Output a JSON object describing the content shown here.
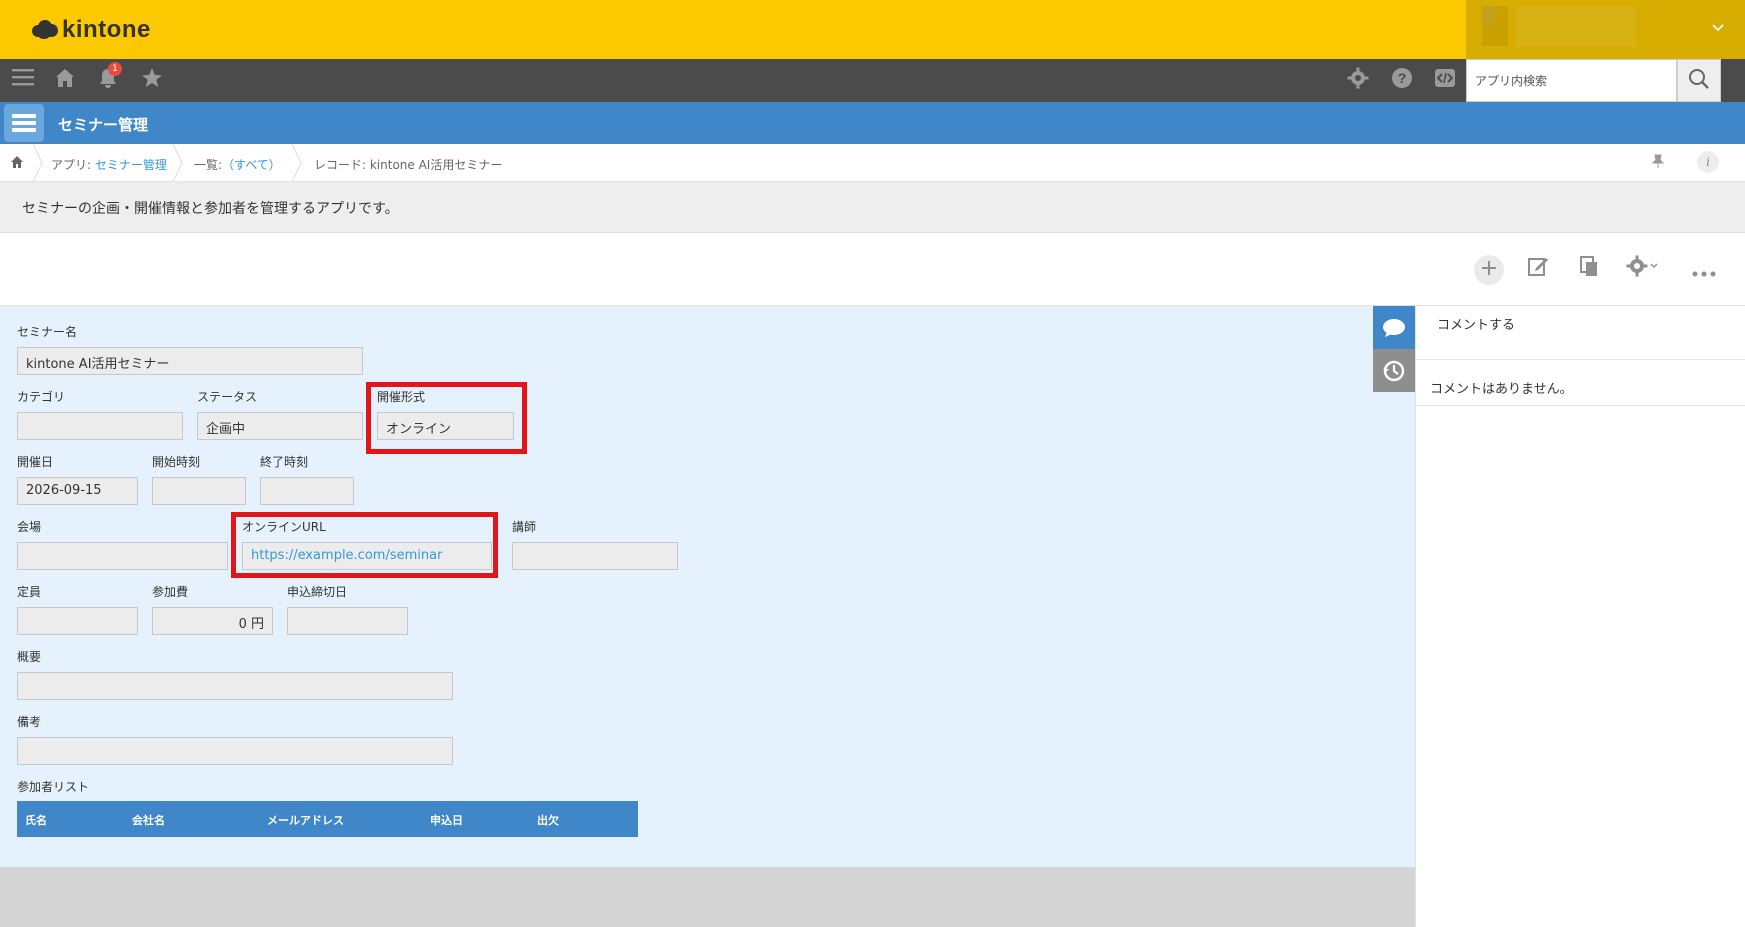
{
  "header": {
    "logo_text": "kintone",
    "search_placeholder": "アプリ内検索",
    "notification_count": "1"
  },
  "app": {
    "title": "セミナー管理"
  },
  "breadcrumb": {
    "app_prefix": "アプリ:",
    "app_name": "セミナー管理",
    "list_prefix": "一覧:",
    "list_name": "（すべて）",
    "record": "レコード: kintone AI活用セミナー"
  },
  "description": "セミナーの企画・開催情報と参加者を管理するアプリです。",
  "form": {
    "seminar_name_label": "セミナー名",
    "seminar_name_value": "kintone AI活用セミナー",
    "category_label": "カテゴリ",
    "category_value": "",
    "status_label": "ステータス",
    "status_value": "企画中",
    "format_label": "開催形式",
    "format_value": "オンライン",
    "date_label": "開催日",
    "date_value": "2026-09-15",
    "start_label": "開始時刻",
    "start_value": "",
    "end_label": "終了時刻",
    "end_value": "",
    "venue_label": "会場",
    "venue_value": "",
    "url_label": "オンラインURL",
    "url_value": "https://example.com/seminar",
    "lecturer_label": "講師",
    "lecturer_value": "",
    "capacity_label": "定員",
    "capacity_value": "",
    "fee_label": "参加費",
    "fee_value": "0 円",
    "deadline_label": "申込締切日",
    "deadline_value": "",
    "summary_label": "概要",
    "summary_value": "",
    "notes_label": "備考",
    "notes_value": "",
    "participants_label": "参加者リスト",
    "participants_columns": [
      "氏名",
      "会社名",
      "メールアドレス",
      "申込日",
      "出欠"
    ]
  },
  "comments": {
    "input_placeholder": "コメントする",
    "empty_text": "コメントはありません。"
  },
  "colors": {
    "header_yellow": "#fcc800",
    "toolbar_dark": "#4b4b4b",
    "app_blue": "#3f87c8",
    "form_bg": "#e5f1fc",
    "highlight_red": "#e2151b"
  }
}
